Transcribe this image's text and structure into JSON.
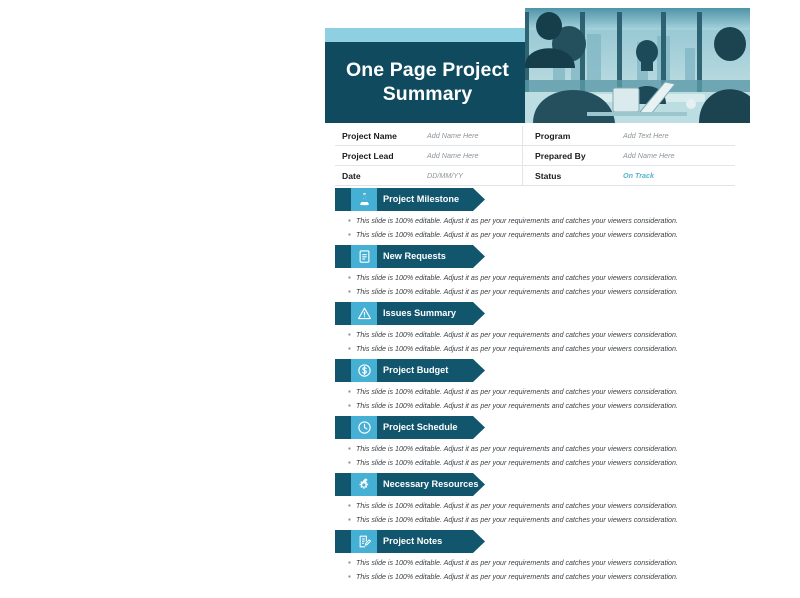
{
  "header": {
    "title": "One Page Project Summary",
    "photo_alt": "business-meeting-photo"
  },
  "info_table": {
    "rows": [
      {
        "label_left": "Project Name",
        "value_left": "Add Name Here",
        "label_right": "Program",
        "value_right": "Add Text Here"
      },
      {
        "label_left": "Project Lead",
        "value_left": "Add Name Here",
        "label_right": "Prepared By",
        "value_right": "Add Name Here"
      },
      {
        "label_left": "Date",
        "value_left": "DD/MM/YY",
        "label_right": "Status",
        "value_right": "On Track"
      }
    ]
  },
  "bullet_text": "This slide is 100% editable. Adjust it as per your requirements and catches your viewers consideration.",
  "sections": [
    {
      "label": "Project Milestone",
      "icon": "flask-icon",
      "bullets": [
        "This slide is 100% editable. Adjust it as per your requirements and catches your viewers consideration.",
        "This slide is 100% editable. Adjust it as per your requirements and catches your viewers consideration."
      ]
    },
    {
      "label": "New Requests",
      "icon": "clipboard-document-icon",
      "bullets": [
        "This slide is 100% editable. Adjust it as per your requirements and catches your viewers consideration.",
        "This slide is 100% editable. Adjust it as per your requirements and catches your viewers consideration."
      ]
    },
    {
      "label": "Issues Summary",
      "icon": "warning-triangle-icon",
      "bullets": [
        "This slide is 100% editable. Adjust it as per your requirements and catches your viewers consideration.",
        "This slide is 100% editable. Adjust it as per your requirements and catches your viewers consideration."
      ]
    },
    {
      "label": "Project Budget",
      "icon": "dollar-circle-icon",
      "bullets": [
        "This slide is 100% editable. Adjust it as per your requirements and catches your viewers consideration.",
        "This slide is 100% editable. Adjust it as per your requirements and catches your viewers consideration."
      ]
    },
    {
      "label": "Project Schedule",
      "icon": "clock-circle-icon",
      "bullets": [
        "This slide is 100% editable. Adjust it as per your requirements and catches your viewers consideration.",
        "This slide is 100% editable. Adjust it as per your requirements and catches your viewers consideration."
      ]
    },
    {
      "label": "Necessary Resources",
      "icon": "gears-icon",
      "bullets": [
        "This slide is 100% editable. Adjust it as per your requirements and catches your viewers consideration.",
        "This slide is 100% editable. Adjust it as per your requirements and catches your viewers consideration."
      ]
    },
    {
      "label": "Project Notes",
      "icon": "note-pencil-icon",
      "bullets": [
        "This slide is 100% editable. Adjust it as per your requirements and catches your viewers consideration.",
        "This slide is 100% editable. Adjust it as per your requirements and catches your viewers consideration."
      ]
    }
  ],
  "colors": {
    "banner_dark": "#12566e",
    "icon_box": "#45b0d4",
    "title_box": "#104a5e",
    "light_bar": "#8ecfe2",
    "status_accent": "#56b4cf"
  }
}
